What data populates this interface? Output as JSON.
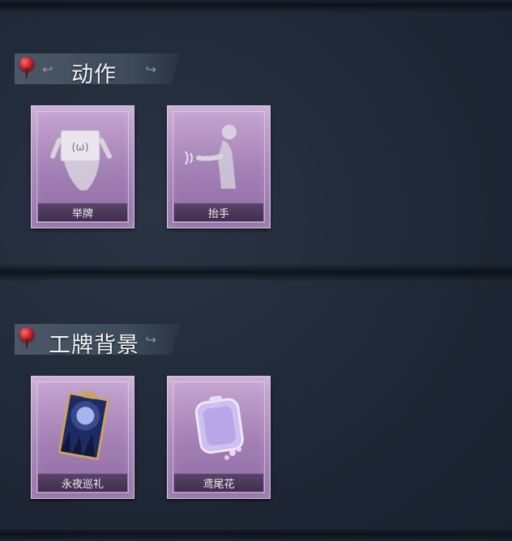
{
  "sections": [
    {
      "title": "动作",
      "items": [
        {
          "label": "举牌",
          "icon": "sign-holding-icon"
        },
        {
          "label": "抬手",
          "icon": "hand-raise-icon"
        }
      ]
    },
    {
      "title": "工牌背景",
      "items": [
        {
          "label": "永夜巡礼",
          "icon": "moonlit-card-icon"
        },
        {
          "label": "鸢尾花",
          "icon": "iris-card-icon"
        }
      ]
    }
  ],
  "colors": {
    "background": "#1f2836",
    "banner": "#4b5868",
    "card": "#a27fb4",
    "label_bar": "#3f2f4c",
    "pin": "#b21b25"
  }
}
